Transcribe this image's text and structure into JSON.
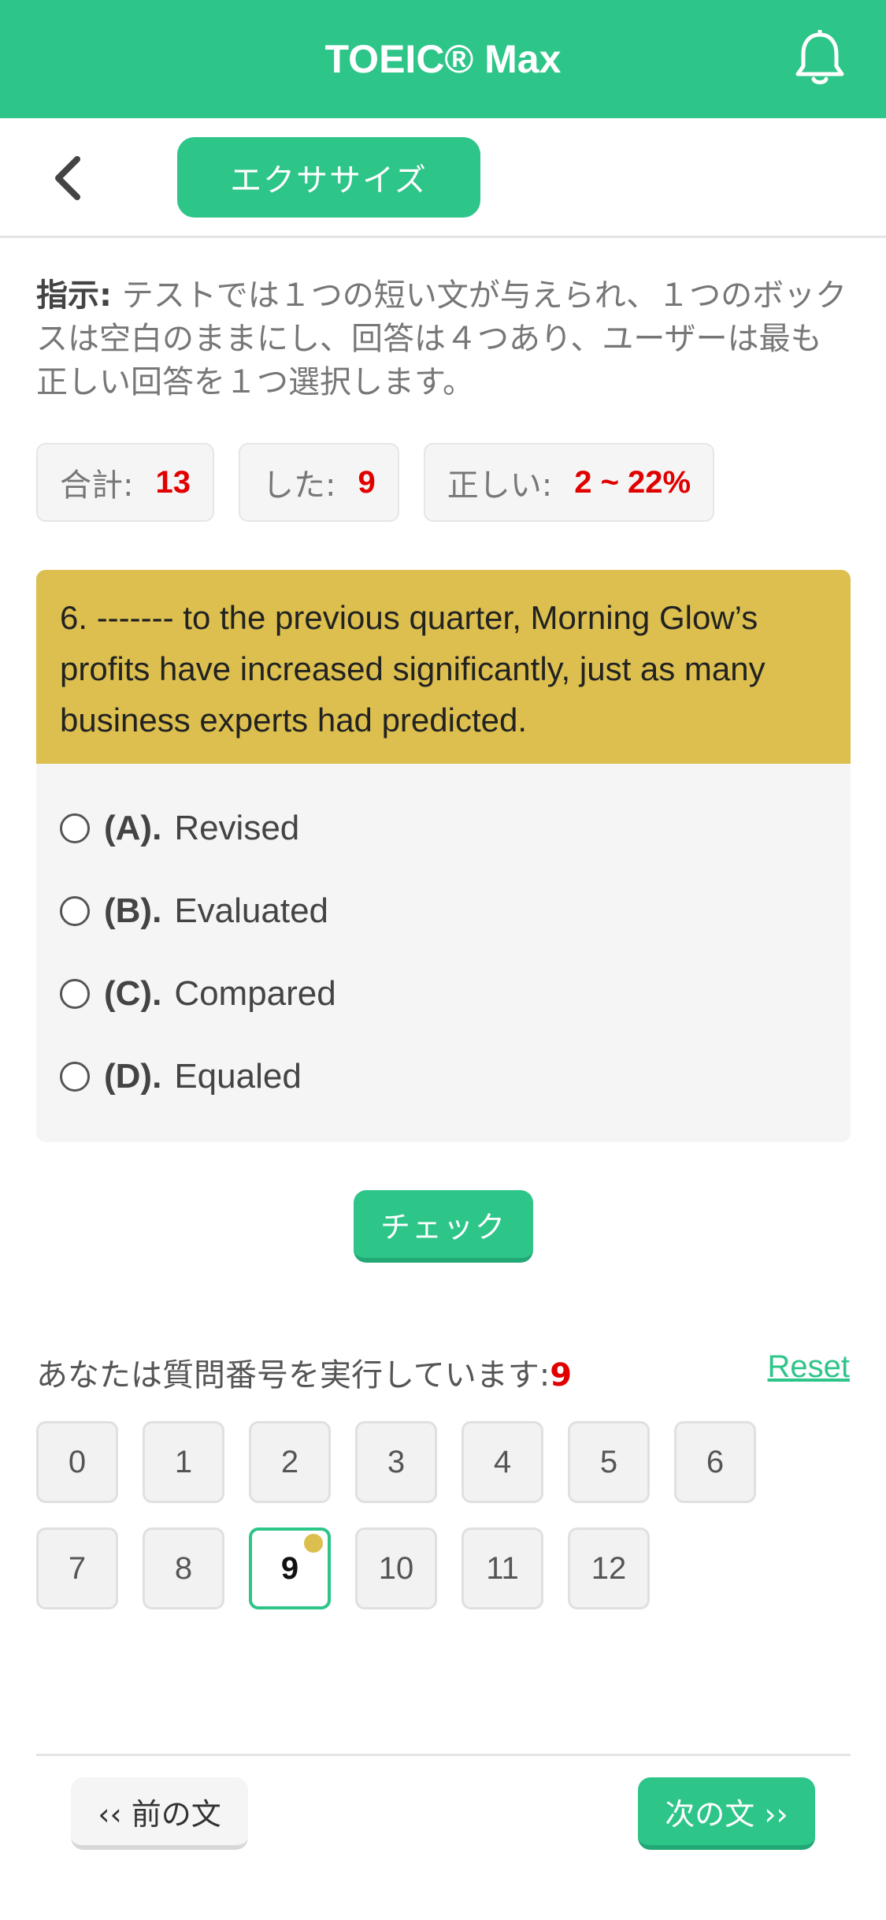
{
  "header": {
    "title": "TOEIC® Max",
    "bell_icon": "bell-icon"
  },
  "nav": {
    "back_icon": "chevron-left-icon",
    "tab_label": "エクササイズ"
  },
  "instructions": {
    "label": "指示:",
    "text": " テストでは１つの短い文が与えられ、１つのボックスは空白のままにし、回答は４つあり、ユーザーは最も正しい回答を１つ選択します。"
  },
  "stats": {
    "total_label": "合計:",
    "total_value": "13",
    "done_label": "した:",
    "done_value": "9",
    "correct_label": "正しい:",
    "correct_value": "2 ~ 22%"
  },
  "question": {
    "text": "6. ------- to the previous quarter, Morning Glow’s profits have increased significantly, just as many business experts had predicted.",
    "options": [
      {
        "letter": "(A).",
        "text": "Revised"
      },
      {
        "letter": "(B).",
        "text": "Evaluated"
      },
      {
        "letter": "(C).",
        "text": "Compared"
      },
      {
        "letter": "(D).",
        "text": "Equaled"
      }
    ]
  },
  "check_label": "チェック",
  "progress": {
    "label": "あなたは質問番号を実行しています:",
    "current": "9",
    "reset_label": "Reset"
  },
  "question_numbers": [
    "0",
    "1",
    "2",
    "3",
    "4",
    "5",
    "6",
    "7",
    "8",
    "9",
    "10",
    "11",
    "12"
  ],
  "active_question": 9,
  "footer": {
    "prev_label": "‹‹ 前の文",
    "next_label": "次の文 ››"
  },
  "colors": {
    "accent": "#2ec589",
    "question_bg": "#dcbf4f",
    "highlight": "#e10000"
  }
}
